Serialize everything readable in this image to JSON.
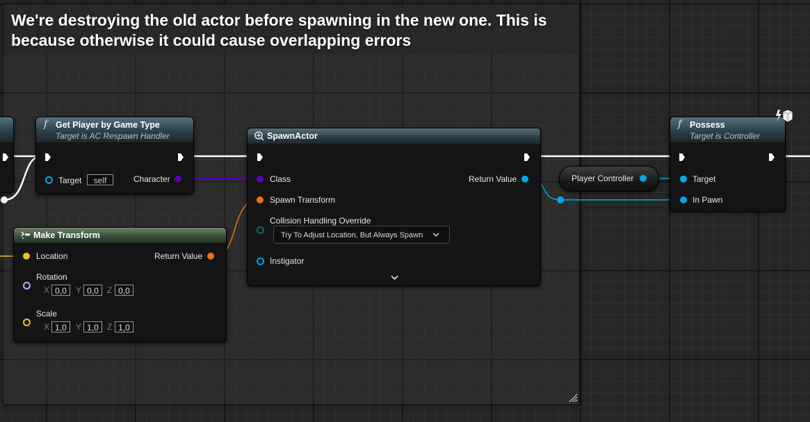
{
  "comment": {
    "text": "We're destroying the old actor before spawning in the new one. This is because otherwise it could cause overlapping errors"
  },
  "nodes": {
    "get_player": {
      "title": "Get Player by Game Type",
      "subtitle": "Target is AC Respawn Handler",
      "target_label": "Target",
      "target_value": "self",
      "output_label": "Character"
    },
    "make_transform": {
      "title": "Make Transform",
      "location_label": "Location",
      "return_label": "Return Value",
      "rotation_label": "Rotation",
      "rotation": {
        "x": "0,0",
        "y": "0,0",
        "z": "0,0"
      },
      "scale_label": "Scale",
      "scale": {
        "x": "1,0",
        "y": "1,0",
        "z": "1,0"
      },
      "axis_x": "X",
      "axis_y": "Y",
      "axis_z": "Z"
    },
    "spawn_actor": {
      "title": "SpawnActor",
      "class_label": "Class",
      "spawn_transform_label": "Spawn Transform",
      "collision_label": "Collision Handling Override",
      "collision_value": "Try To Adjust Location, But Always Spawn",
      "instigator_label": "Instigator",
      "return_label": "Return Value"
    },
    "player_controller": {
      "label": "Player Controller"
    },
    "possess": {
      "title": "Possess",
      "subtitle": "Target is Controller",
      "target_label": "Target",
      "in_pawn_label": "In Pawn"
    }
  },
  "icons": {
    "function": "f",
    "spawn": "spawn-actor-icon",
    "make": "make-struct-icon",
    "authority": "lightning-cube-icon",
    "expand": "chevron-down-icon"
  },
  "colors": {
    "exec": "#ffffff",
    "object": "#00a8f0",
    "class": "#5a00b4",
    "transform": "#f07010",
    "vector": "#f0c020",
    "rotator": "#9fb4ff",
    "collision": "#0b6b6b"
  }
}
